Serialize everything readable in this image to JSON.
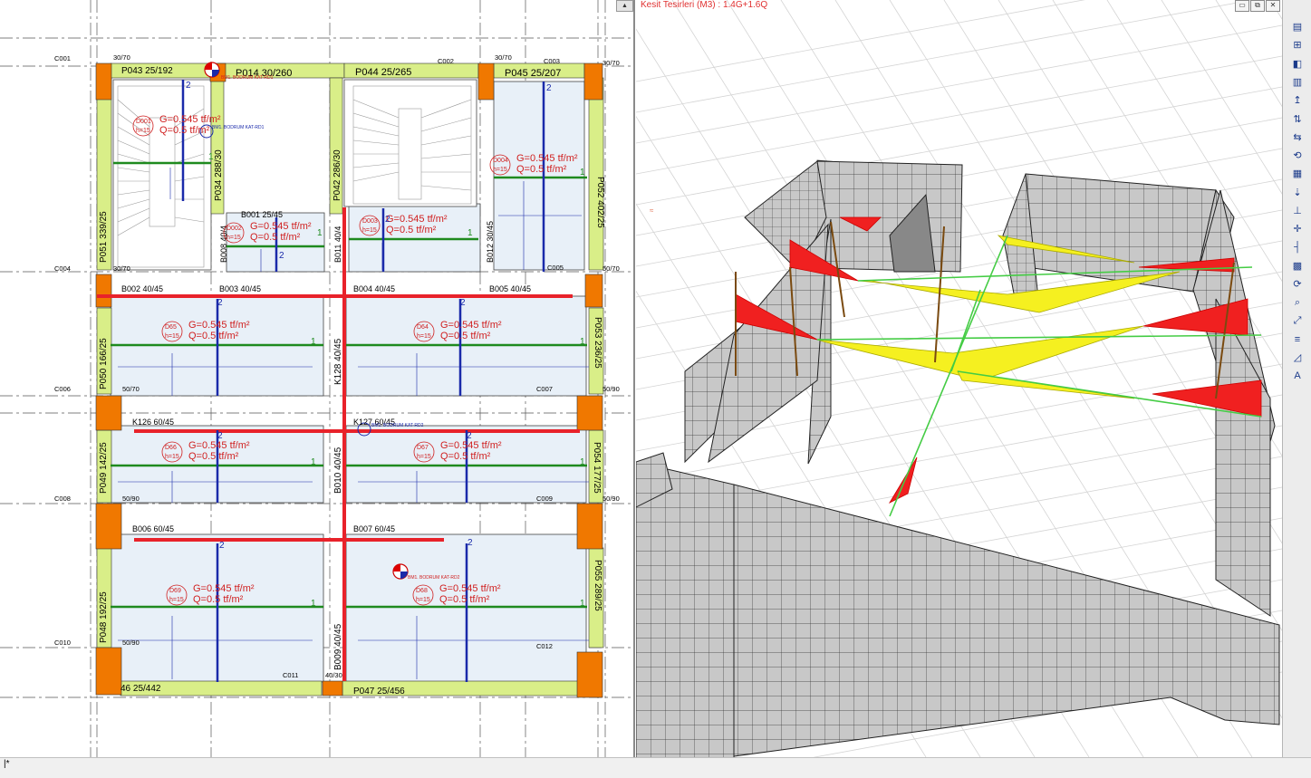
{
  "view3d": {
    "title": "Kesit Tesirleri (M3) : 1.4G+1.6Q",
    "window_controls": [
      "▭",
      "⧉",
      "✕"
    ]
  },
  "status": {
    "text": "|*"
  },
  "plan": {
    "axis_labels": [
      "C001",
      "C002",
      "C003",
      "C004",
      "C005",
      "C006",
      "C007",
      "C008",
      "C009",
      "C010",
      "C011",
      "C012"
    ],
    "beams": [
      "P043 25/192",
      "P014 30/260",
      "P044 25/265",
      "P045 25/207",
      "P051 339/25",
      "P034 288/30",
      "P042 286/30",
      "P052 402/25",
      "B001 25/45",
      "B008 40/4",
      "B011 40/4",
      "B012 30/45",
      "B002 40/45",
      "B003 40/45",
      "B004 40/45",
      "B005 40/45",
      "P050 166/25",
      "P053 236/25",
      "K128 40/45",
      "K126 60/45",
      "K127 60/45",
      "B010 40/45",
      "P049 142/25",
      "P054 177/25",
      "B006 60/45",
      "B007 60/45",
      "P048 192/25",
      "P055 289/25",
      "B009 40/45",
      "P047 25/456",
      "46 25/442"
    ],
    "column_labels": [
      "30/70",
      "30/70",
      "30/70",
      "30/70",
      "50/70",
      "50/70",
      "50/90",
      "50/90",
      "50/90",
      "50/90",
      "40/30"
    ],
    "slab_ids": [
      "D001",
      "D002",
      "D003",
      "D004",
      "D65",
      "D64",
      "D66",
      "D67",
      "D69",
      "D68"
    ],
    "load_g": "G=0.545 tf/m²",
    "load_q": "Q=0.5 tf/m²",
    "slab_h": "h=15",
    "marker_label": "BM1. BODRUM KAT-RD1",
    "marker_label2": "BM1. BODRUM KAT-RD2",
    "span_num_1": "1",
    "span_num_2": "2"
  },
  "toolbar": {
    "icons": [
      "section-icon",
      "beam-icon",
      "column-icon",
      "wall-icon",
      "moment-icon",
      "shear-icon",
      "axial-icon",
      "torsion-icon",
      "slab-icon",
      "load-icon",
      "support-icon",
      "node-icon",
      "member-icon",
      "grid-icon",
      "rotate-icon",
      "zoom-icon",
      "fit-icon",
      "rebar-icon",
      "diagram-icon",
      "text-icon"
    ],
    "glyphs": [
      "▤",
      "⊞",
      "◧",
      "▥",
      "↥",
      "⇅",
      "⇆",
      "⟲",
      "▦",
      "⇣",
      "⊥",
      "✛",
      "┤",
      "▩",
      "⟳",
      "⌕",
      "⤢",
      "≡",
      "◿",
      "A"
    ]
  },
  "colors": {
    "beam_red": "#e8222a",
    "slab_green": "#1e8a1e",
    "col_orange": "#f07800",
    "edge_yellow": "#d9ee88",
    "slab_fill": "#e8f0f8",
    "diagram_yellow": "#f5f020",
    "diagram_red": "#f02020",
    "wall_gray": "#c8c8c8"
  }
}
